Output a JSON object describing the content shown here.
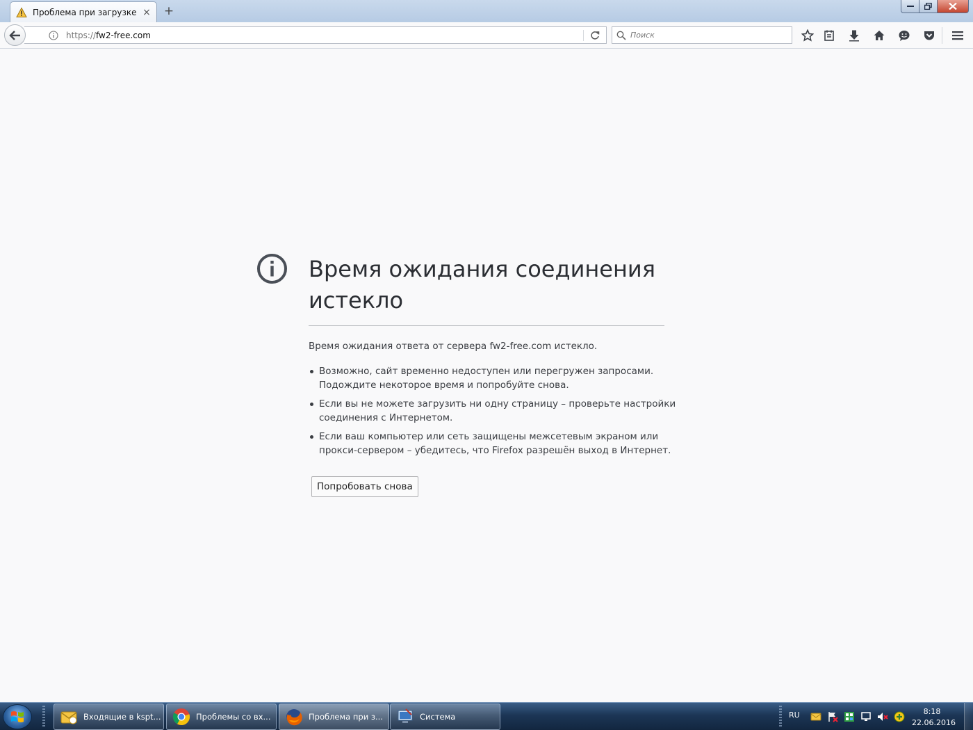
{
  "tab": {
    "title": "Проблема при загрузке с...",
    "close": "×",
    "new_tab": "+"
  },
  "navbar": {
    "url_protocol": "https://",
    "url_host": "fw2-free.com",
    "search_placeholder": "Поиск"
  },
  "error_page": {
    "title": "Время ожидания соединения истекло",
    "description": "Время ожидания ответа от сервера fw2-free.com истекло.",
    "bullets": [
      "Возможно, сайт временно недоступен или перегружен запросами. Подождите некоторое время и попробуйте снова.",
      "Если вы не можете загрузить ни одну страницу – проверьте настройки соединения с Интернетом.",
      "Если ваш компьютер или сеть защищены межсетевым экраном или прокси-сервером – убедитесь, что Firefox разрешён выход в Интернет."
    ],
    "try_again_label": "Попробовать снова"
  },
  "taskbar": {
    "items": [
      {
        "label": "Входящие в kspt...",
        "icon": "outlook-icon"
      },
      {
        "label": "Проблемы со вх...",
        "icon": "chrome-icon"
      },
      {
        "label": "Проблема при з...",
        "icon": "firefox-icon"
      },
      {
        "label": "Система",
        "icon": "system-icon"
      }
    ],
    "language": "RU",
    "time": "8:18",
    "date": "22.06.2016"
  },
  "colors": {
    "page_background": "#f9f9fa",
    "title_text": "#2b2e33",
    "info_icon": "#4a4f57",
    "close_button": "#c4452f",
    "taskbar": "#1c3656"
  }
}
